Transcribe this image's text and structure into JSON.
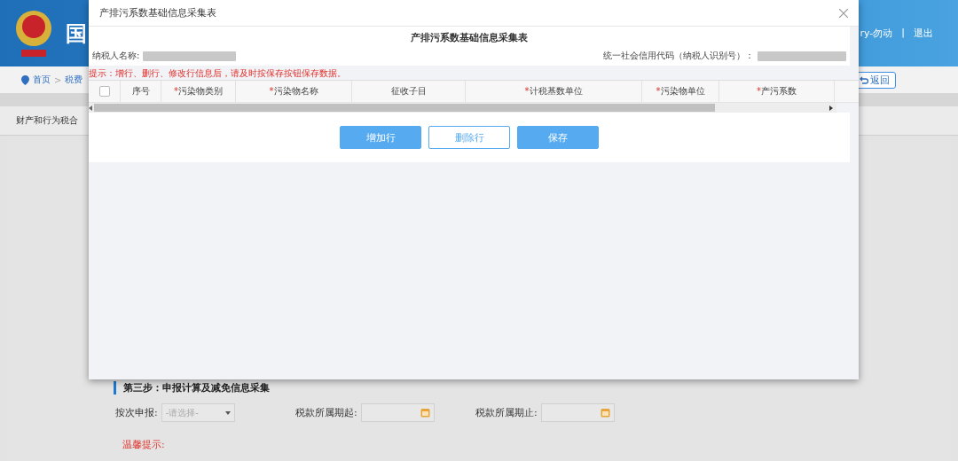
{
  "background_page": {
    "header": {
      "title": "国",
      "user": "ry-勿动",
      "separator": "|",
      "logout": "退出"
    },
    "breadcrumb": [
      {
        "label": "首页"
      },
      {
        "label": "税费"
      }
    ],
    "breadcrumb_separator": ">",
    "back_button": "返回",
    "tab_label": "财产和行为税合",
    "section_title": "第三步：申报计算及减免信息采集",
    "form_fields": [
      {
        "label": "按次申报:",
        "kind": "select",
        "placeholder": "-请选择-"
      },
      {
        "label": "税款所属期起:",
        "kind": "date"
      },
      {
        "label": "税款所属期止:",
        "kind": "date"
      }
    ],
    "notice_title": "温馨提示:"
  },
  "dialog": {
    "title": "产排污系数基础信息采集表",
    "heading": "产排污系数基础信息采集表",
    "taxpayer_name_label": "纳税人名称:",
    "credit_code_label": "统一社会信用代码（纳税人识别号）：",
    "hint": "提示：增行、删行、修改行信息后，请及时按保存按钮保存数据。",
    "table": {
      "select_all": {
        "checked": false
      },
      "columns": [
        {
          "label": "序号"
        },
        {
          "label": "污染物类别",
          "required_mark": "*"
        },
        {
          "label": "污染物名称",
          "required_mark": "*"
        },
        {
          "label": "征收子目"
        },
        {
          "label": "计税基数单位",
          "required_mark": "*"
        },
        {
          "label": "污染物单位",
          "required_mark": "*"
        },
        {
          "label": "产污系数",
          "required_mark": "*"
        }
      ]
    },
    "buttons": [
      {
        "label": "增加行",
        "kind": "primary"
      },
      {
        "label": "删除行",
        "kind": "outline"
      },
      {
        "label": "保存",
        "kind": "primary"
      }
    ]
  }
}
